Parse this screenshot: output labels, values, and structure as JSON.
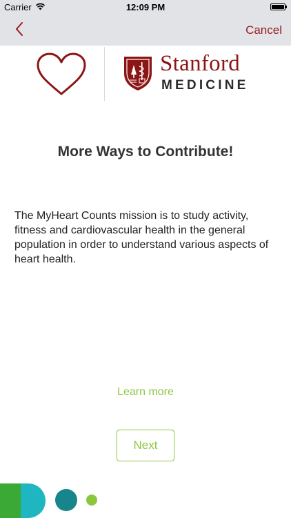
{
  "status_bar": {
    "carrier": "Carrier",
    "time": "12:09 PM"
  },
  "nav": {
    "cancel_label": "Cancel"
  },
  "header": {
    "org_name": "Stanford",
    "org_subtitle": "MEDICINE"
  },
  "content": {
    "title": "More Ways to Contribute!",
    "description": "The MyHeart Counts mission is to study activity, fitness and cardiovascular health in the general population in order to understand various aspects of heart health.",
    "learn_more_label": "Learn more",
    "next_label": "Next"
  },
  "colors": {
    "brand_red": "#8c1515",
    "accent_green": "#8cc63f",
    "nav_background": "#e1e3e6"
  },
  "icons": {
    "back": "chevron-left-icon",
    "wifi": "wifi-icon",
    "battery": "battery-icon",
    "heart": "heart-outline-icon",
    "seal": "stanford-seal-icon"
  }
}
